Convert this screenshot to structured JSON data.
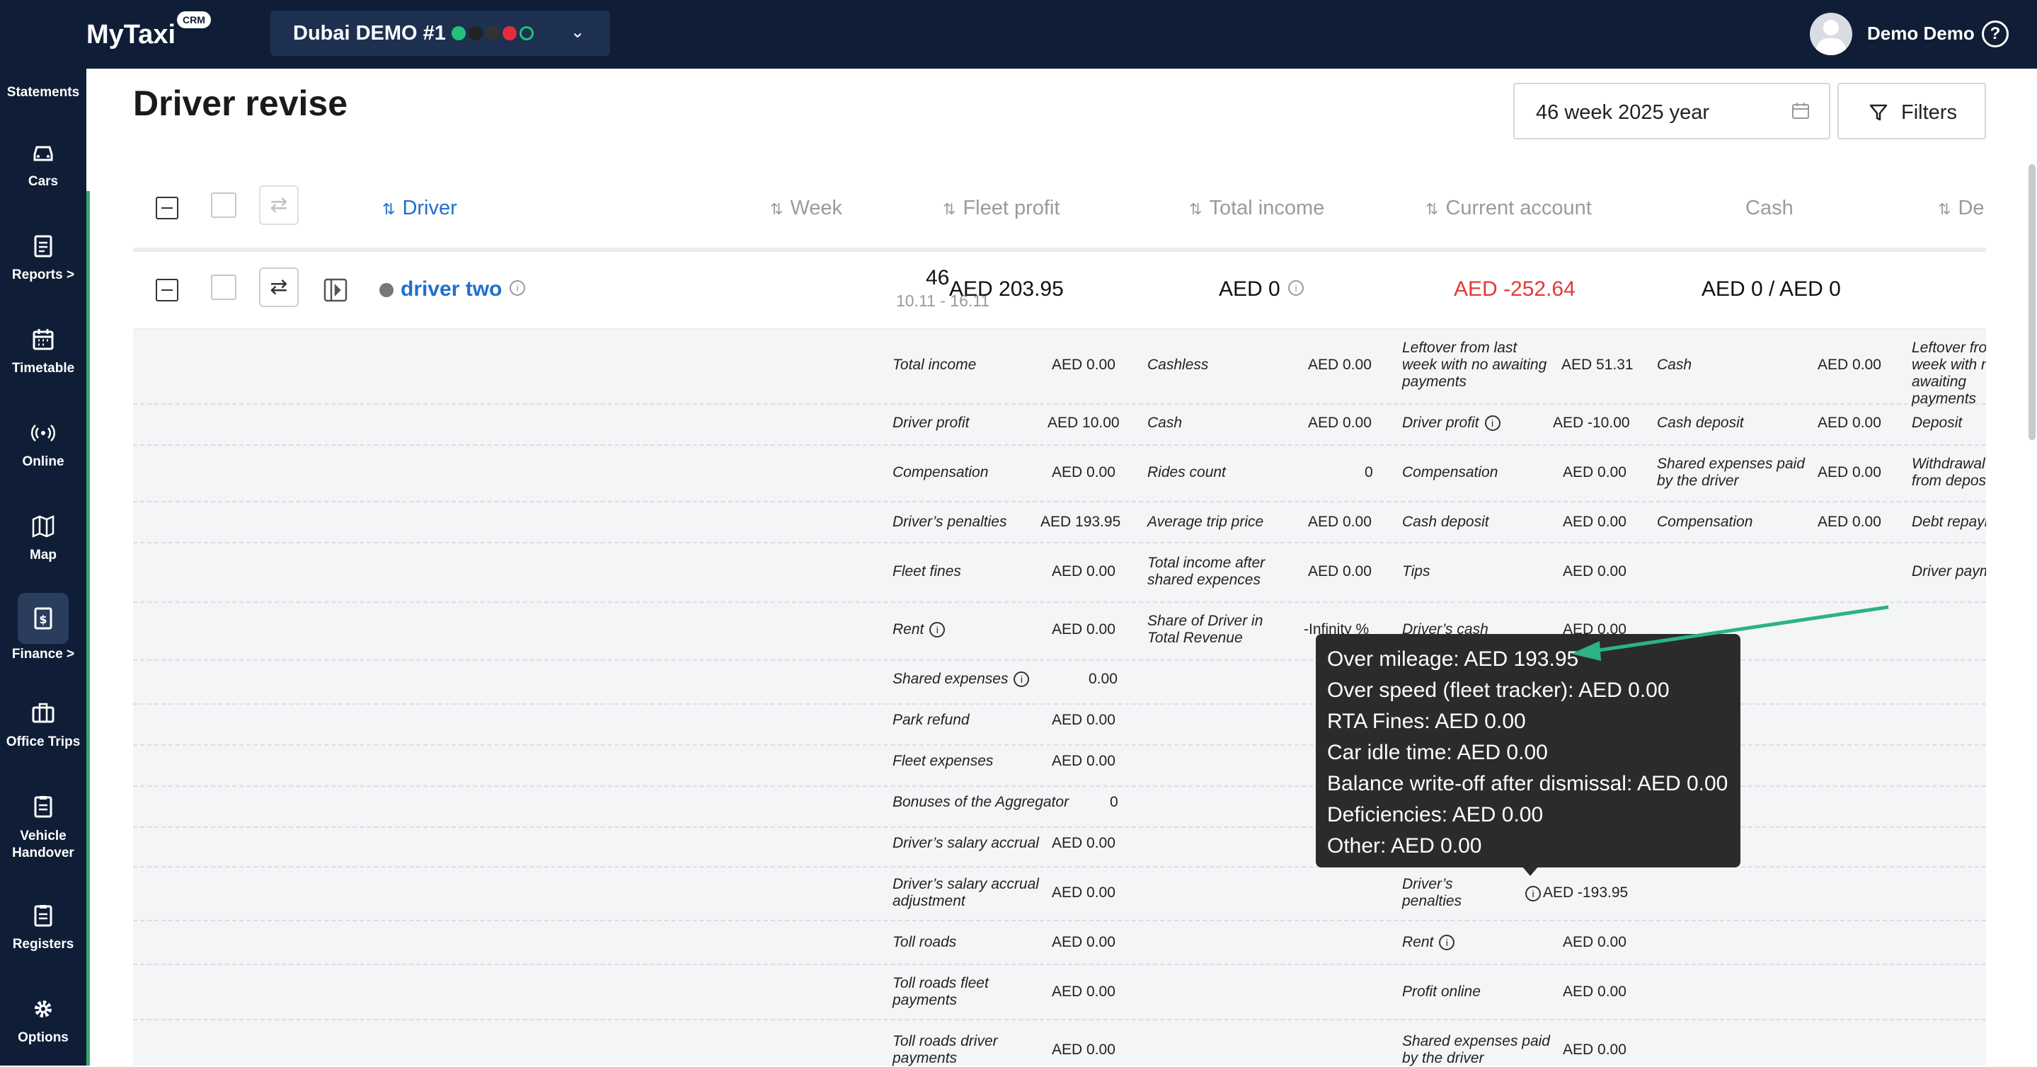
{
  "app": {
    "logo": "MyTaxi",
    "logo_badge": "CRM",
    "company": "Dubai DEMO #1",
    "user": "Demo Demo"
  },
  "sidebar": [
    {
      "label": "Statements",
      "icon": "statements-icon"
    },
    {
      "label": "Cars",
      "icon": "car-icon"
    },
    {
      "label": "Reports >",
      "icon": "reports-icon"
    },
    {
      "label": "Timetable",
      "icon": "calendar-icon"
    },
    {
      "label": "Online",
      "icon": "broadcast-icon"
    },
    {
      "label": "Map",
      "icon": "map-icon"
    },
    {
      "label": "Finance >",
      "icon": "finance-icon"
    },
    {
      "label": "Office Trips",
      "icon": "briefcase-icon"
    },
    {
      "label": "Vehicle Handover",
      "icon": "clipboard-icon"
    },
    {
      "label": "Registers",
      "icon": "clipboard-icon"
    },
    {
      "label": "Options",
      "icon": "gear-icon"
    }
  ],
  "page": {
    "title": "Driver revise",
    "date_value": "46 week 2025 year",
    "filters_label": "Filters"
  },
  "table": {
    "headers": [
      "Driver",
      "Week",
      "Fleet profit",
      "Total income",
      "Current account",
      "Cash",
      "De"
    ],
    "row": {
      "driver": "driver two",
      "week": "46",
      "week_range": "10.11 - 16.11",
      "fleet_profit": "AED 203.95",
      "total_income": "AED 0",
      "current_account": "AED -252.64",
      "cash": "AED 0 / AED 0"
    }
  },
  "details": {
    "col1": [
      {
        "label": "Total income",
        "value": "AED 0.00"
      },
      {
        "label": "Driver profit",
        "value": "AED 10.00"
      },
      {
        "label": "Compensation",
        "value": "AED 0.00"
      },
      {
        "label": "Driver’s penalties",
        "value": "AED 193.95"
      },
      {
        "label": "Fleet fines",
        "value": "AED 0.00"
      },
      {
        "label": "Rent",
        "value": "AED 0.00"
      },
      {
        "label": "Shared expenses",
        "value": "0.00"
      },
      {
        "label": "Park refund",
        "value": "AED 0.00"
      },
      {
        "label": "Fleet expenses",
        "value": "AED 0.00"
      },
      {
        "label": "Bonuses of the Aggregator",
        "value": "0"
      },
      {
        "label": "Driver’s salary accrual",
        "value": "AED 0.00"
      },
      {
        "label": "Driver’s salary accrual adjustment",
        "value": "AED 0.00"
      },
      {
        "label": "Toll roads",
        "value": "AED 0.00"
      },
      {
        "label": "Toll roads fleet payments",
        "value": "AED 0.00"
      },
      {
        "label": "Toll roads driver payments",
        "value": "AED 0.00"
      }
    ],
    "col2": [
      {
        "label": "Cashless",
        "value": "AED 0.00"
      },
      {
        "label": "Cash",
        "value": "AED 0.00"
      },
      {
        "label": "Rides count",
        "value": "0"
      },
      {
        "label": "Average trip price",
        "value": "AED 0.00"
      },
      {
        "label": "Total income after shared expences",
        "value": "AED 0.00"
      },
      {
        "label": "Share of Driver in Total Revenue",
        "value": "-Infinity %"
      }
    ],
    "col3": [
      {
        "label": "Leftover from last week with no awaiting payments",
        "value": "AED 51.31"
      },
      {
        "label": "Driver profit",
        "value": "AED -10.00"
      },
      {
        "label": "Compensation",
        "value": "AED 0.00"
      },
      {
        "label": "Cash deposit",
        "value": "AED 0.00"
      },
      {
        "label": "Tips",
        "value": "AED 0.00"
      },
      {
        "label": "Driver’s cash",
        "value": "AED 0.00"
      },
      {
        "label": "Driver’s penalties",
        "value": "AED -193.95"
      },
      {
        "label": "Rent",
        "value": "AED 0.00"
      },
      {
        "label": "Profit online",
        "value": "AED 0.00"
      },
      {
        "label": "Shared expenses paid by the driver",
        "value": "AED 0.00"
      }
    ],
    "col4": [
      {
        "label": "Cash",
        "value": "AED 0.00"
      },
      {
        "label": "Cash deposit",
        "value": "AED 0.00"
      },
      {
        "label": "Shared expenses paid by the driver",
        "value": "AED 0.00"
      },
      {
        "label": "Compensation",
        "value": "AED 0.00"
      }
    ],
    "col5": [
      {
        "label": "Leftover from last week with no awaiting payments"
      },
      {
        "label": "Deposit"
      },
      {
        "label": "Withdrawal from deposit"
      },
      {
        "label": "Debt repayment"
      },
      {
        "label": "Driver payments"
      }
    ]
  },
  "tooltip": [
    "Over mileage: AED 193.95",
    "Over speed (fleet tracker): AED 0.00",
    "RTA Fines: AED 0.00",
    "Car idle time: AED 0.00",
    "Balance write-off after dismissal: AED 0.00",
    "Deficiencies: AED 0.00",
    "Other: AED 0.00"
  ],
  "colors": {
    "topbar": "#0f1e36",
    "accent_blue": "#1f6fd0",
    "negative_red": "#e03a3a",
    "arrow_green": "#2bb384"
  }
}
